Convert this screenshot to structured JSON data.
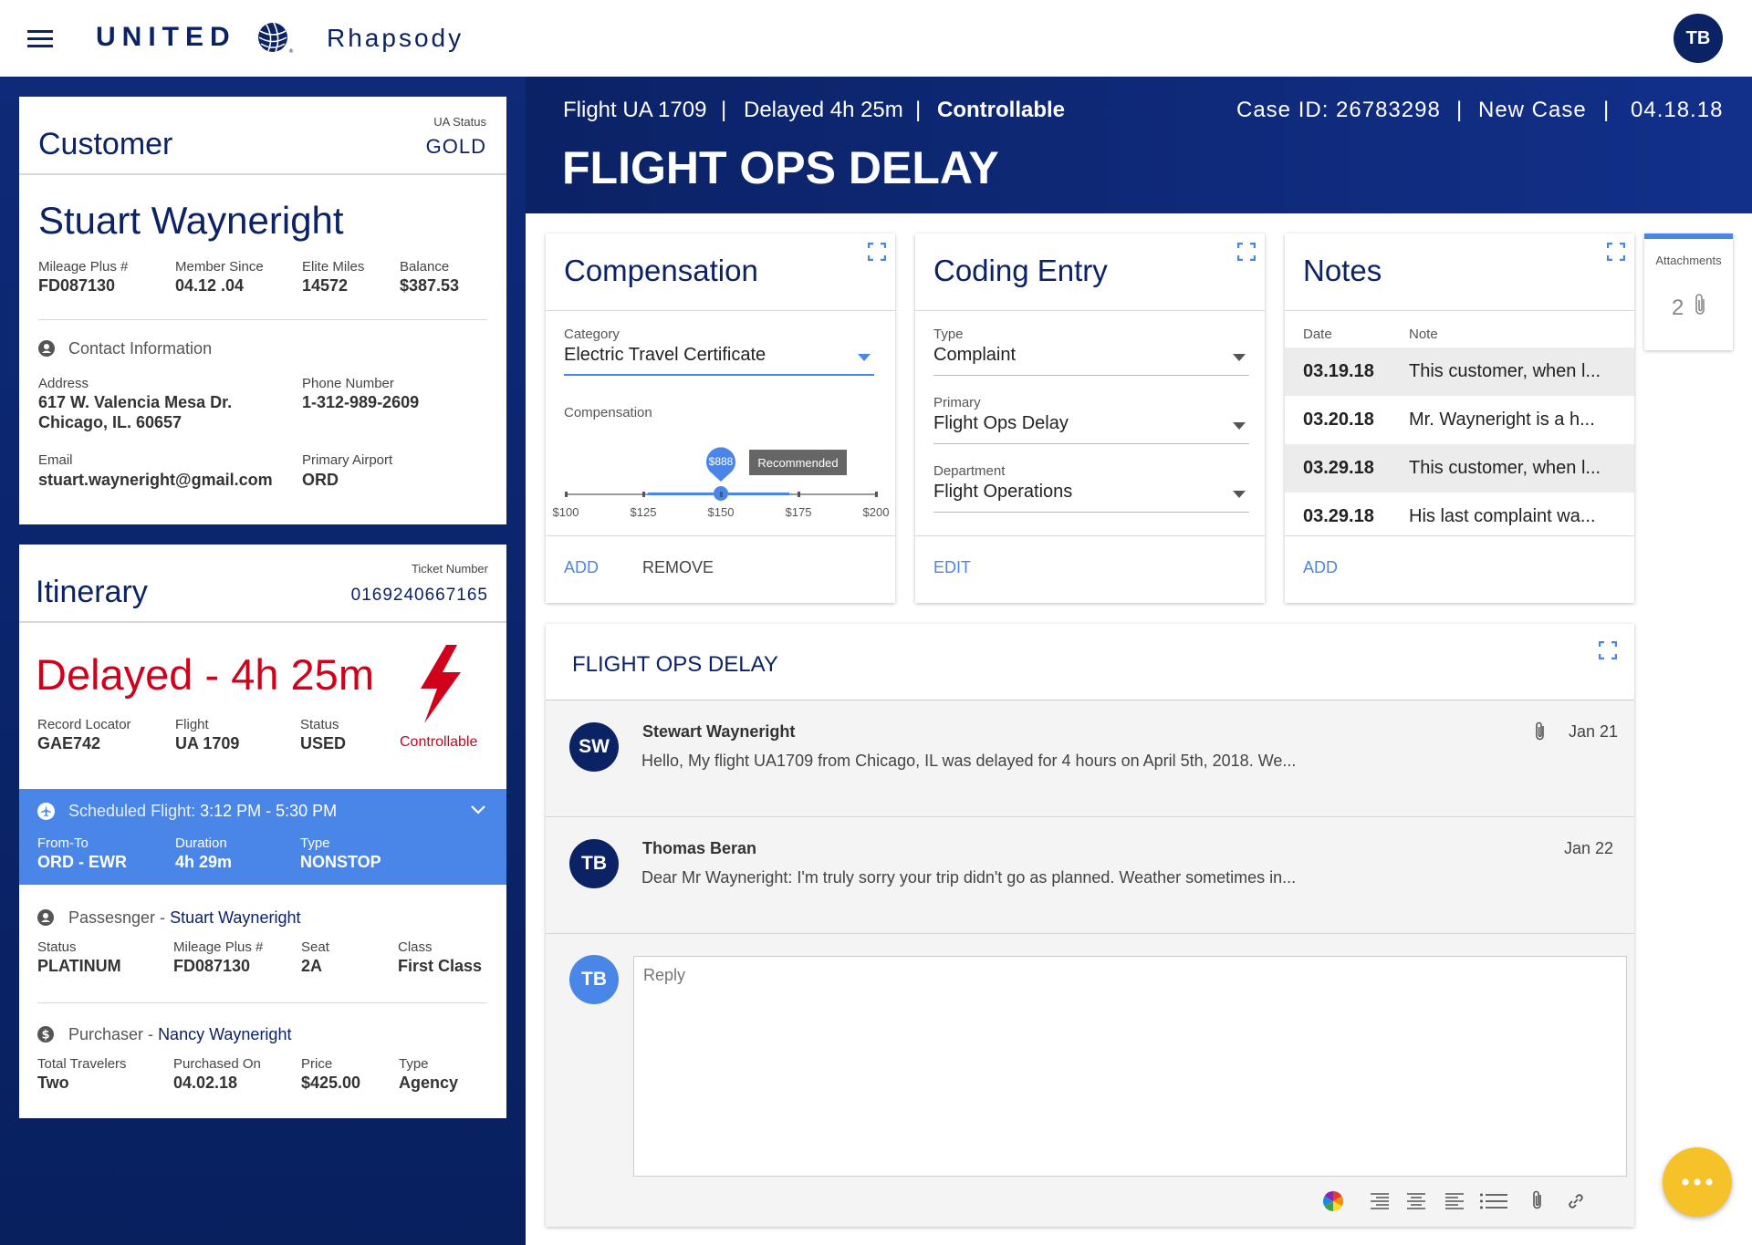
{
  "topbar": {
    "logo": "UNITED",
    "app_name": "Rhapsody",
    "user_initials": "TB"
  },
  "header": {
    "flight": "Flight UA 1709",
    "delay": "Delayed 4h 25m",
    "controllable": "Controllable",
    "case_id": "Case ID: 26783298",
    "case_status": "New Case",
    "date": "04.18.18",
    "title": "FLIGHT OPS DELAY",
    "sep": "|"
  },
  "customer": {
    "title": "Customer",
    "status_label": "UA Status",
    "status_value": "GOLD",
    "name": "Stuart Wayneright",
    "fields": [
      {
        "label": "Mileage Plus #",
        "value": "FD087130"
      },
      {
        "label": "Member Since",
        "value": "04.12 .04"
      },
      {
        "label": "Elite Miles",
        "value": "14572"
      },
      {
        "label": "Balance",
        "value": "$387.53"
      }
    ],
    "contact_heading": "Contact Information",
    "address_label": "Address",
    "address_line1": "617 W. Valencia Mesa Dr.",
    "address_line2": "Chicago, IL. 60657",
    "phone_label": "Phone Number",
    "phone_value": "1-312-989-2609",
    "email_label": "Email",
    "email_value": "stuart.wayneright@gmail.com",
    "airport_label": "Primary Airport",
    "airport_value": "ORD"
  },
  "itinerary": {
    "title": "Itinerary",
    "ticket_label": "Ticket Number",
    "ticket_value": "0169240667165",
    "delay_text": "Delayed - 4h 25m",
    "controllable": "Controllable",
    "fields": [
      {
        "label": "Record Locator",
        "value": "GAE742"
      },
      {
        "label": "Flight",
        "value": "UA 1709"
      },
      {
        "label": "Status",
        "value": "USED"
      }
    ],
    "scheduled_label": "Scheduled Flight:",
    "scheduled_time": "3:12 PM - 5:30 PM",
    "sched_fields": [
      {
        "label": "From-To",
        "value": "ORD - EWR"
      },
      {
        "label": "Duration",
        "value": "4h 29m"
      },
      {
        "label": "Type",
        "value": "NONSTOP"
      }
    ],
    "passenger_label": "Passesnger -",
    "passenger_name": "Stuart Wayneright",
    "passenger_fields": [
      {
        "label": "Status",
        "value": "PLATINUM"
      },
      {
        "label": "Mileage Plus #",
        "value": "FD087130"
      },
      {
        "label": "Seat",
        "value": "2A"
      },
      {
        "label": "Class",
        "value": "First Class"
      }
    ],
    "purchaser_label": "Purchaser -",
    "purchaser_name": "Nancy Wayneright",
    "purchaser_fields": [
      {
        "label": "Total Travelers",
        "value": "Two"
      },
      {
        "label": "Purchased On",
        "value": "04.02.18"
      },
      {
        "label": "Price",
        "value": "$425.00"
      },
      {
        "label": "Type",
        "value": "Agency"
      }
    ]
  },
  "compensation": {
    "title": "Compensation",
    "category_label": "Category",
    "category_value": "Electric Travel Certificate",
    "comp_label": "Compensation",
    "slider_value_label": "$888",
    "recommended": "Recommended",
    "ticks": [
      "$100",
      "$125",
      "$150",
      "$175",
      "$200"
    ],
    "slider_fraction": 0.5,
    "add": "ADD",
    "remove": "REMOVE"
  },
  "coding": {
    "title": "Coding Entry",
    "type_label": "Type",
    "type_value": "Complaint",
    "primary_label": "Primary",
    "primary_value": "Flight Ops Delay",
    "dept_label": "Department",
    "dept_value": "Flight Operations",
    "edit": "EDIT"
  },
  "notes": {
    "title": "Notes",
    "date_header": "Date",
    "note_header": "Note",
    "rows": [
      {
        "date": "03.19.18",
        "note": "This customer, when l..."
      },
      {
        "date": "03.20.18",
        "note": "Mr. Wayneright is a h..."
      },
      {
        "date": "03.29.18",
        "note": "This customer, when l..."
      },
      {
        "date": "03.29.18",
        "note": "His last complaint wa..."
      }
    ],
    "add": "ADD"
  },
  "attachments": {
    "label": "Attachments",
    "count": "2"
  },
  "conversation": {
    "title": "FLIGHT OPS DELAY",
    "messages": [
      {
        "initials": "SW",
        "author": "Stewart Wayneright",
        "date": "Jan 21",
        "text": "Hello, My flight UA1709 from Chicago, IL was delayed for 4 hours on April 5th, 2018. We..."
      },
      {
        "initials": "TB",
        "author": "Thomas Beran",
        "date": "Jan 22",
        "text": "Dear Mr Wayneright: I'm truly sorry your trip didn't go as planned. Weather sometimes in..."
      }
    ],
    "reply_initials": "TB",
    "reply_placeholder": "Reply"
  },
  "colors": {
    "navy": "#0b2265",
    "accent_blue": "#4a86e8",
    "delay_red": "#d0021b",
    "fab_yellow": "#f6c22a"
  }
}
